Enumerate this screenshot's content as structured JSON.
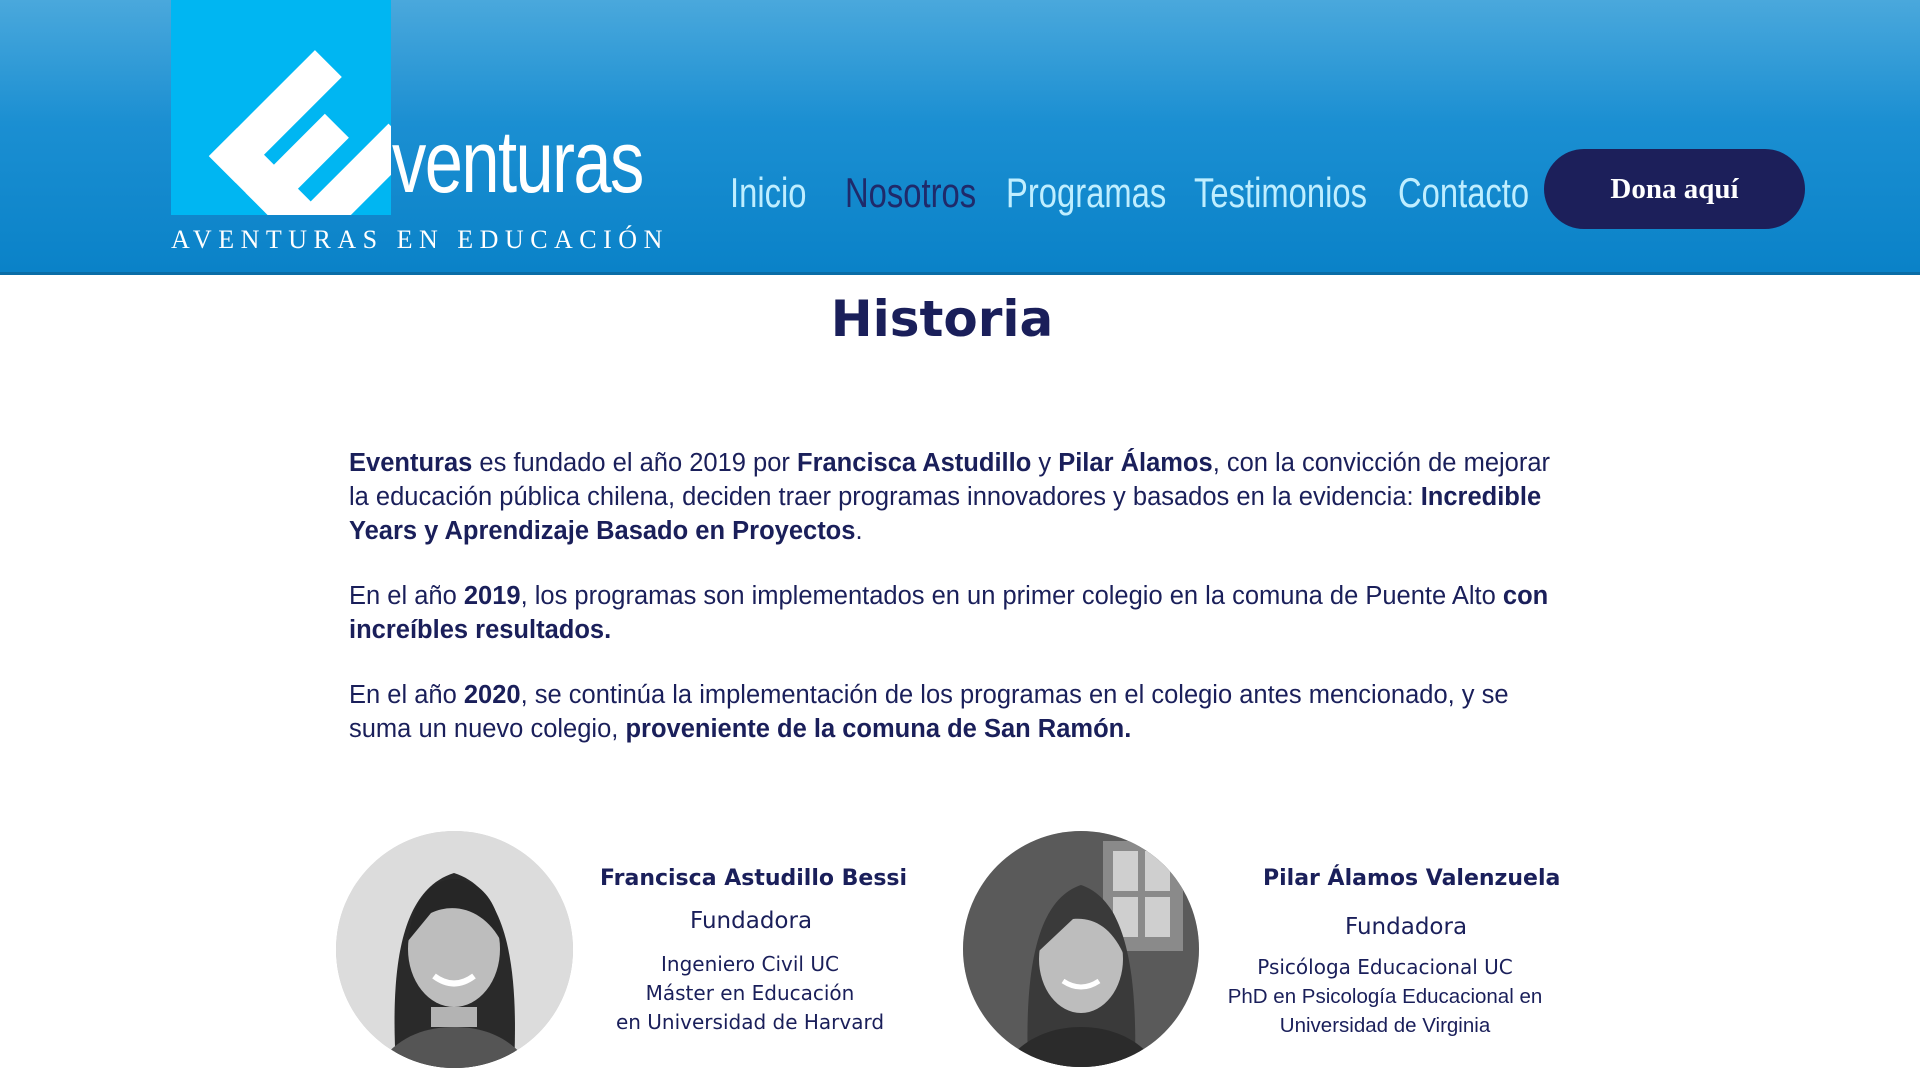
{
  "brand": {
    "logo_letter": "E",
    "logo_word": "venturas",
    "tagline": "AVENTURAS EN EDUCACIÓN",
    "colors": {
      "header": "#1b8fd2",
      "logo_square": "#00b6f2",
      "navy": "#1c1f5a",
      "nav_link": "#bfeeff"
    }
  },
  "nav": {
    "items": [
      {
        "label": "Inicio"
      },
      {
        "label": "Nosotros",
        "active": true
      },
      {
        "label": "Programas"
      },
      {
        "label": "Testimonios"
      },
      {
        "label": "Contacto"
      }
    ],
    "donate_label": "Dona aquí"
  },
  "page": {
    "title": "Historia",
    "paragraphs": {
      "p1": {
        "b1": "Eventuras",
        "t1": " es fundado el año 2019 por ",
        "b2": "Francisca Astudillo",
        "t2": " y ",
        "b3": "Pilar Álamos",
        "t3": ", con la convicción de mejorar la educación pública chilena, deciden traer programas innovadores y basados en la evidencia: ",
        "b4": "Incredible Years y Aprendizaje Basado en Proyectos",
        "t4": "."
      },
      "p2": {
        "t1": "En el año ",
        "b1": "2019",
        "t2": ", los programas son implementados en un primer colegio en la comuna de Puente Alto ",
        "b2": "con increíbles resultados."
      },
      "p3": {
        "t1": "En el año ",
        "b1": "2020",
        "t2": ", se continúa la implementación de los programas en el colegio antes mencionado, y se suma un nuevo colegio, ",
        "b2": "proveniente de la comuna de San Ramón."
      }
    }
  },
  "founders": [
    {
      "name": "Francisca Astudillo Bessi",
      "role": "Fundadora",
      "creds": [
        "Ingeniero Civil UC",
        "Máster en Educación",
        "en Universidad de Harvard"
      ]
    },
    {
      "name": "Pilar Álamos Valenzuela",
      "role": "Fundadora",
      "creds": [
        "Psicóloga Educacional UC",
        "PhD en Psicología Educacional en",
        "Universidad de Virginia"
      ]
    }
  ]
}
